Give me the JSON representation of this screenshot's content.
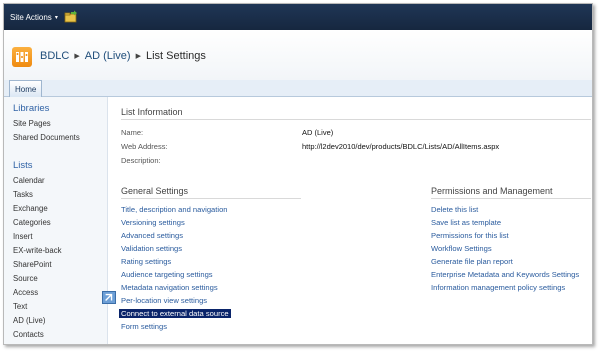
{
  "topbar": {
    "site_actions": "Site Actions",
    "caret": "▾"
  },
  "breadcrumb": {
    "site": "BDLC",
    "list": "AD (Live)",
    "page": "List Settings",
    "sep": "▶"
  },
  "tabs": [
    {
      "label": "Home"
    }
  ],
  "quicklaunch": {
    "libraries_heading": "Libraries",
    "libraries": [
      "Site Pages",
      "Shared Documents"
    ],
    "lists_heading": "Lists",
    "lists": [
      "Calendar",
      "Tasks",
      "Exchange",
      "Categories",
      "Insert",
      "EX-write-back",
      "SharePoint",
      "Source",
      "Access",
      "Text",
      "AD (Live)",
      "Contacts"
    ]
  },
  "list_information": {
    "title": "List Information",
    "name_label": "Name:",
    "name_value": "AD (Live)",
    "web_address_label": "Web Address:",
    "web_address_value": "http://l2dev2010/dev/products/BDLC/Lists/AD/AllItems.aspx",
    "description_label": "Description:"
  },
  "general_settings": {
    "title": "General Settings",
    "links": [
      "Title, description and navigation",
      "Versioning settings",
      "Advanced settings",
      "Validation settings",
      "Rating settings",
      "Audience targeting settings",
      "Metadata navigation settings",
      "Per-location view settings",
      "Connect to external data source",
      "Form settings"
    ],
    "selected_index": 8
  },
  "permissions": {
    "title": "Permissions and Management",
    "links": [
      "Delete this list",
      "Save list as template",
      "Permissions for this list",
      "Workflow Settings",
      "Generate file plan report",
      "Enterprise Metadata and Keywords Settings",
      "Information management policy settings"
    ]
  },
  "colors": {
    "accent": "#1f3656",
    "link": "#2b5c9e",
    "heading": "#3063a6",
    "selection": "#0a246a"
  },
  "icons": [
    "navigate-up-icon",
    "site-logo-icon",
    "cursor-arrow-icon"
  ]
}
